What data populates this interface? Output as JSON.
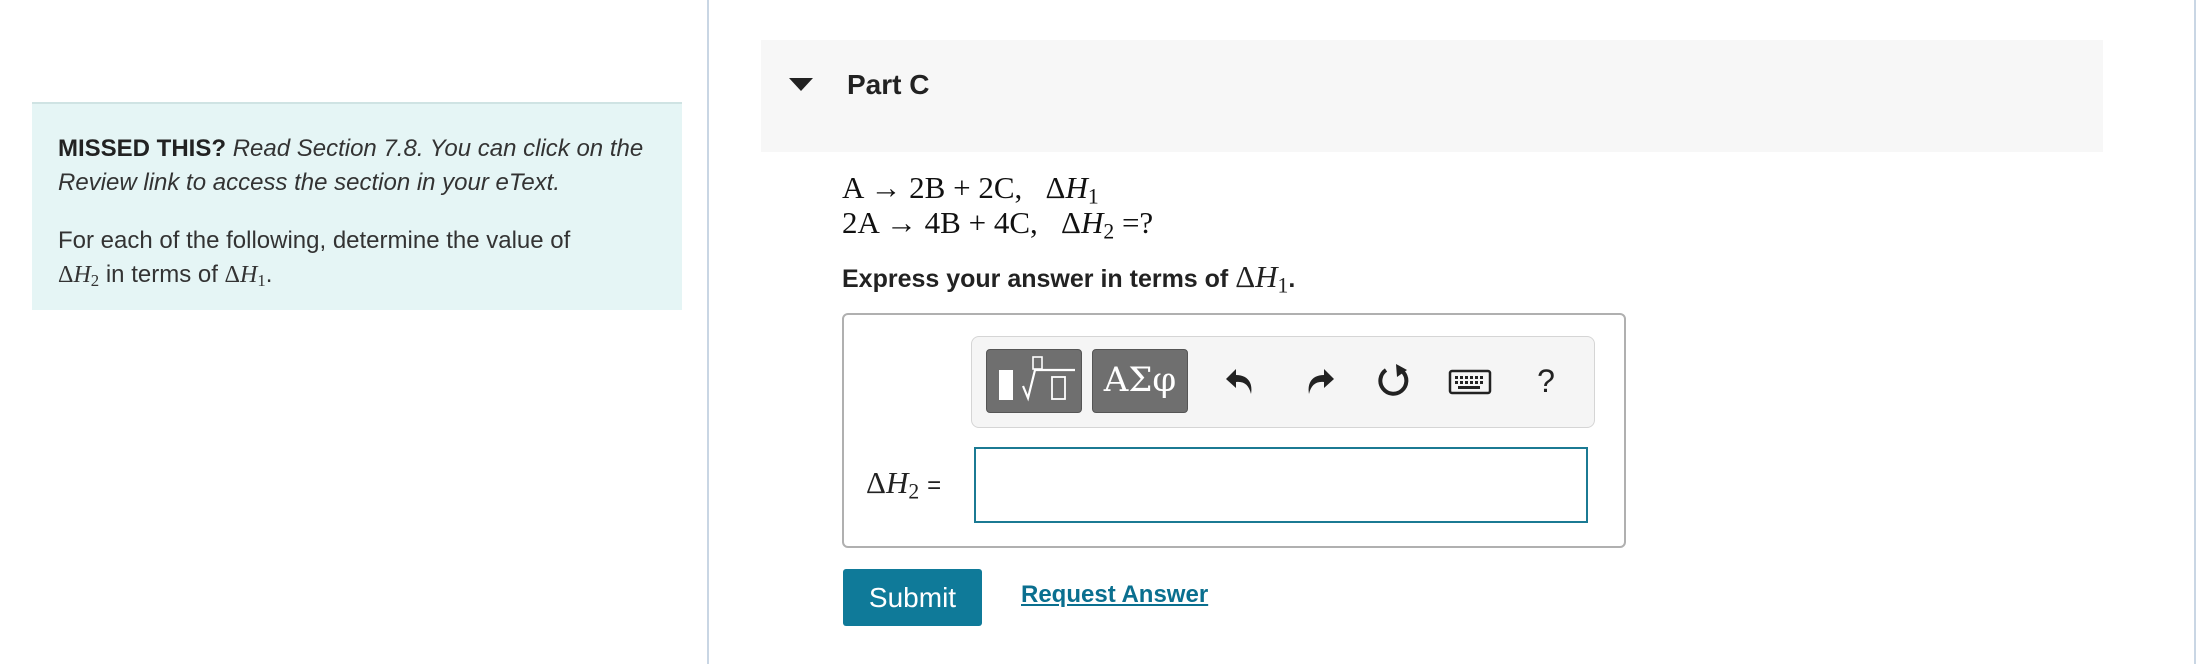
{
  "hint": {
    "missed_label": "MISSED THIS?",
    "read_text": "Read Section 7.8. You can click on the Review link to access the section in your eText.",
    "instruction_prefix": "For each of the following, determine the value of",
    "delta_symbol": "Δ",
    "h_var": "H",
    "sub_2": "2",
    "in_terms_of": "in terms of",
    "sub_1": "1",
    "period": "."
  },
  "part": {
    "title": "Part C"
  },
  "equations": {
    "line1": "A → 2B + 2C,   Δ",
    "line1_var": "H",
    "line1_sub": "1",
    "line2": "2A → 4B + 4C,   Δ",
    "line2_var": "H",
    "line2_sub": "2",
    "line2_tail": " =?"
  },
  "instruction": {
    "text": "Express your answer in terms of",
    "math_delta": "Δ",
    "math_var": "H",
    "math_sub": "1",
    "period": "."
  },
  "toolbar": {
    "greek_label": "ΑΣφ",
    "help_label": "?",
    "icons": [
      "templates-icon",
      "greek-letters-icon",
      "undo-icon",
      "redo-icon",
      "reset-icon",
      "keyboard-icon",
      "help-icon"
    ]
  },
  "answer": {
    "lhs_delta": "Δ",
    "lhs_var": "H",
    "lhs_sub": "2",
    "lhs_equals": "=",
    "value": ""
  },
  "actions": {
    "submit_label": "Submit",
    "request_label": "Request Answer"
  },
  "colors": {
    "hint_bg": "#e5f5f5",
    "submit_bg": "#0f7a99",
    "link": "#0a6f8f",
    "input_border": "#1b7a93"
  }
}
